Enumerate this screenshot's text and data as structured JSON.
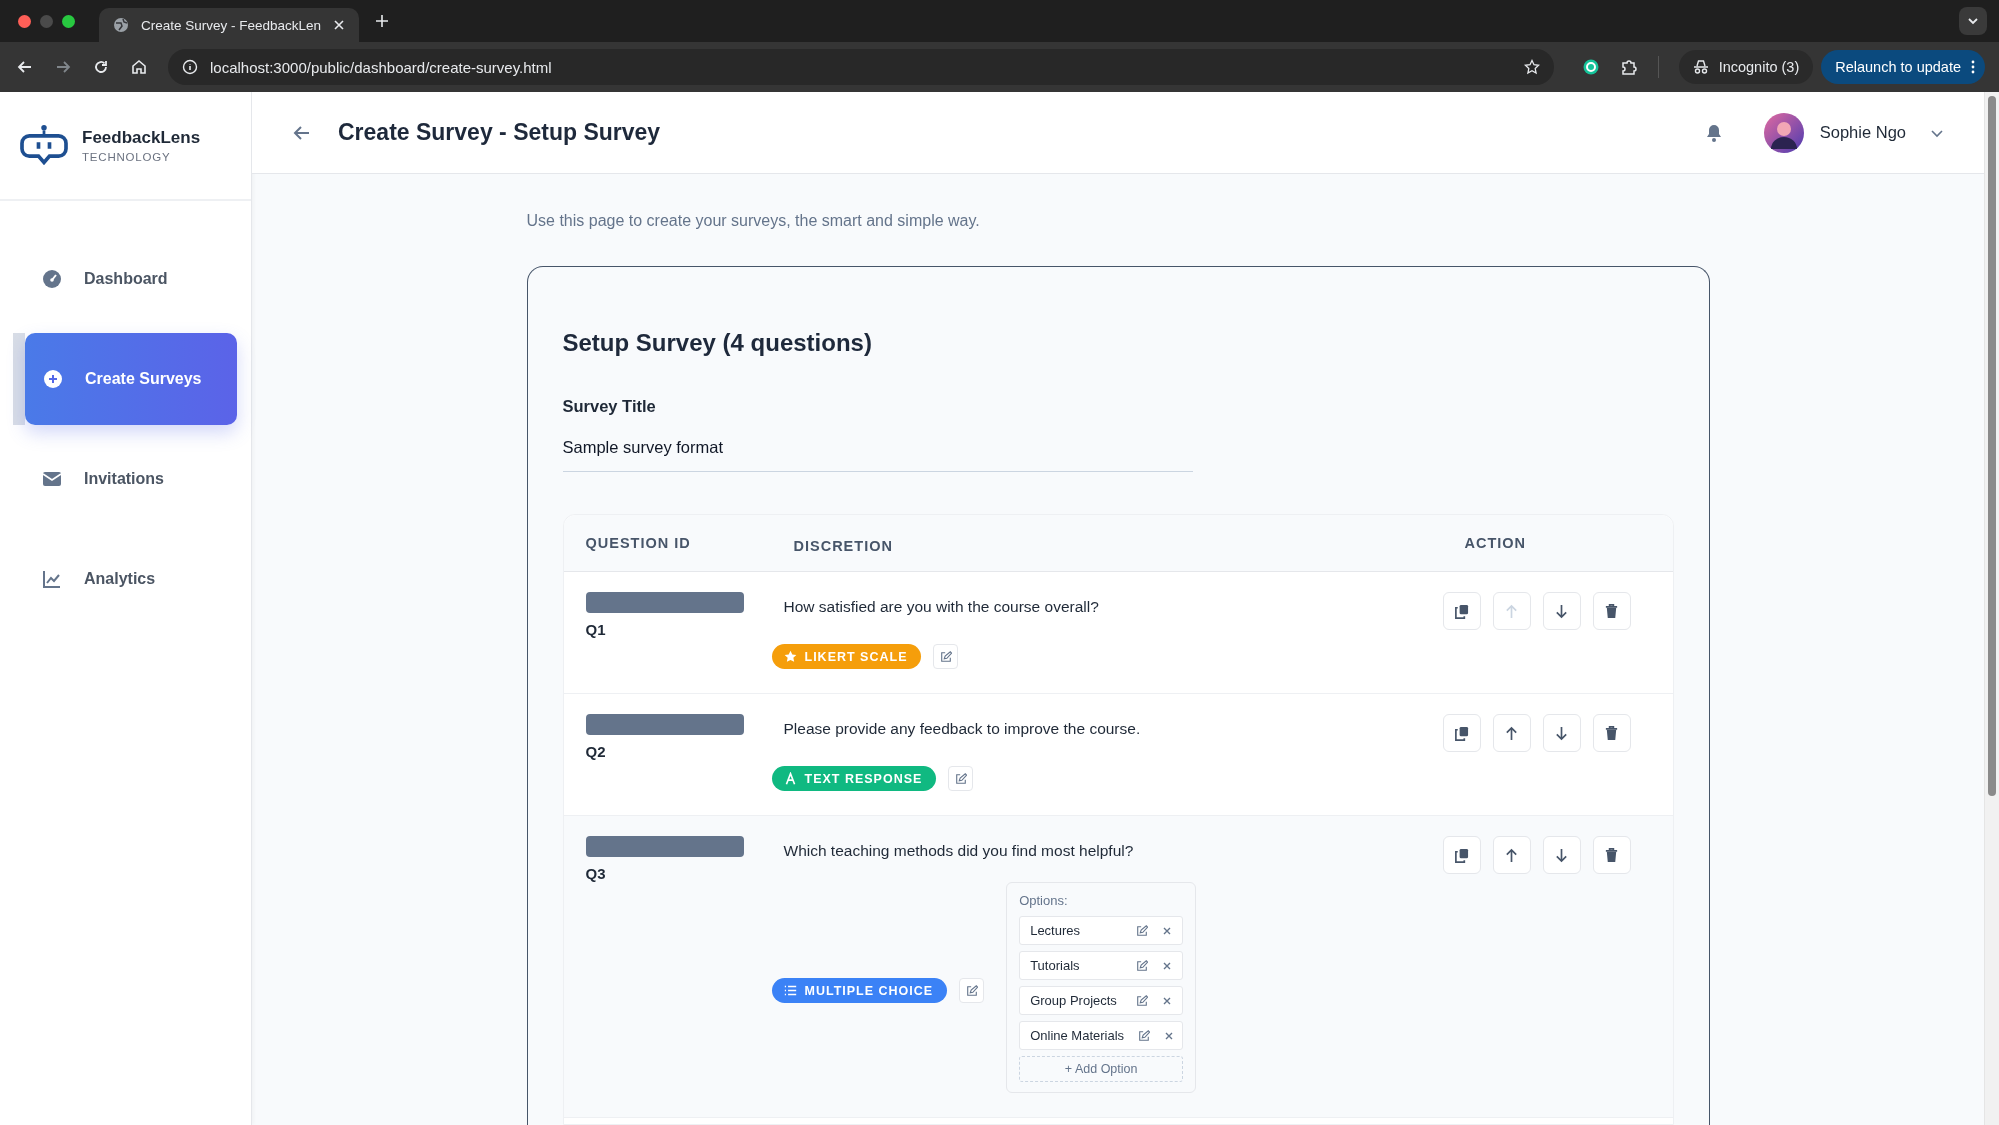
{
  "browser": {
    "tab_title": "Create Survey - FeedbackLen",
    "url": "localhost:3000/public/dashboard/create-survey.html",
    "incognito": "Incognito (3)",
    "relaunch": "Relaunch to update"
  },
  "brand": {
    "name": "FeedbackLens",
    "tagline": "TECHNOLOGY"
  },
  "sidebar": {
    "items": [
      {
        "label": "Dashboard",
        "kind": "dashboard",
        "selected": false
      },
      {
        "label": "Create Surveys",
        "kind": "create",
        "selected": true
      },
      {
        "label": "Invitations",
        "kind": "invitations",
        "selected": false
      },
      {
        "label": "Analytics",
        "kind": "analytics",
        "selected": false
      }
    ]
  },
  "header": {
    "title": "Create Survey - Setup Survey",
    "user": "Sophie Ngo"
  },
  "intro": "Use this page to create your surveys, the smart and simple way.",
  "survey": {
    "heading": "Setup Survey (4 questions)",
    "title_label": "Survey Title",
    "title_value": "Sample survey format",
    "table": {
      "columns": [
        "QUESTION ID",
        "DISCRETION",
        "ACTION"
      ],
      "rows": [
        {
          "id": "Q1",
          "question": "How satisfied are you with the course overall?",
          "type": {
            "kind": "likert",
            "label": "LIKERT SCALE"
          },
          "actions": [
            {
              "kind": "duplicate",
              "disabled": false
            },
            {
              "kind": "up",
              "disabled": true
            },
            {
              "kind": "down",
              "disabled": false
            },
            {
              "kind": "delete",
              "disabled": false
            }
          ]
        },
        {
          "id": "Q2",
          "question": "Please provide any feedback to improve the course.",
          "type": {
            "kind": "text",
            "label": "TEXT RESPONSE"
          },
          "actions": [
            {
              "kind": "duplicate",
              "disabled": false
            },
            {
              "kind": "up",
              "disabled": false
            },
            {
              "kind": "down",
              "disabled": false
            },
            {
              "kind": "delete",
              "disabled": false
            }
          ]
        },
        {
          "id": "Q3",
          "question": "Which teaching methods did you find most helpful?",
          "type": {
            "kind": "multiple",
            "label": "MULTIPLE CHOICE"
          },
          "actions": [
            {
              "kind": "duplicate",
              "disabled": false
            },
            {
              "kind": "up",
              "disabled": false
            },
            {
              "kind": "down",
              "disabled": false
            },
            {
              "kind": "delete",
              "disabled": false
            }
          ],
          "options_label": "Options:",
          "options": [
            "Lectures",
            "Tutorials",
            "Group Projects",
            "Online Materials"
          ],
          "add_option": "+ Add Option"
        }
      ]
    }
  }
}
